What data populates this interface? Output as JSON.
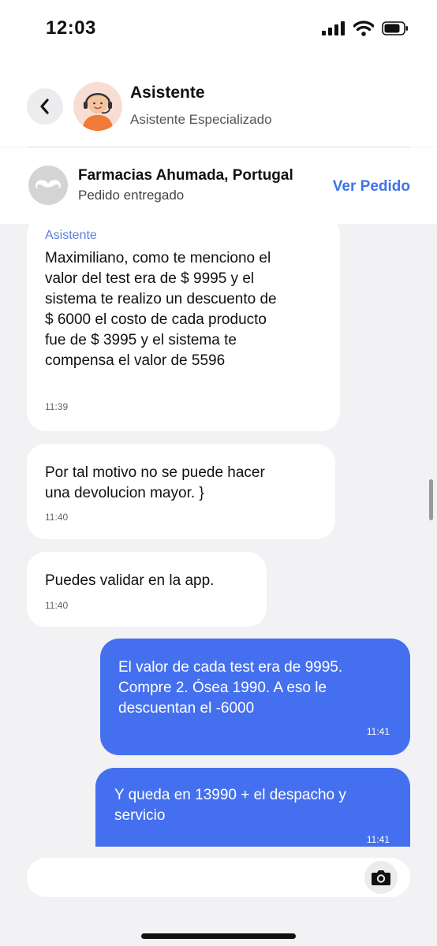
{
  "status_bar": {
    "time": "12:03"
  },
  "header": {
    "title": "Asistente",
    "subtitle": "Asistente Especializado"
  },
  "order": {
    "store_name": "Farmacias Ahumada, Portugal",
    "status": "Pedido entregado",
    "view_label": "Ver Pedido"
  },
  "messages": [
    {
      "direction": "incoming",
      "sender": "Asistente",
      "lines": [
        "Maximiliano, como te menciono el",
        "valor del test era de $ 9995 y el",
        "sistema te realizo un descuento de",
        "$ 6000 el costo de cada producto",
        "fue de $ 3995 y el sistema te",
        "compensa el valor de 5596"
      ],
      "time": "11:39"
    },
    {
      "direction": "incoming",
      "lines": [
        "Por tal motivo no se puede hacer",
        "una devolucion mayor. }"
      ],
      "time": "11:40"
    },
    {
      "direction": "incoming",
      "lines": [
        "Puedes validar en la app."
      ],
      "time": "11:40"
    },
    {
      "direction": "outgoing",
      "lines": [
        "El valor de cada test era de 9995.",
        "Compre 2. Ósea 1990. A eso le",
        "descuentan el -6000"
      ],
      "time": "11:41"
    },
    {
      "direction": "outgoing",
      "lines": [
        "Y queda en 13990 + el despacho y",
        "servicio"
      ],
      "time": "11:41"
    }
  ],
  "input": {
    "placeholder": ""
  },
  "icons": {
    "back": "chevron-left-icon",
    "camera": "camera-icon",
    "store": "mustache-logo-icon"
  },
  "colors": {
    "accent": "#3f74e8",
    "outgoing_bubble": "#4470ef",
    "background": "#f2f2f4"
  }
}
